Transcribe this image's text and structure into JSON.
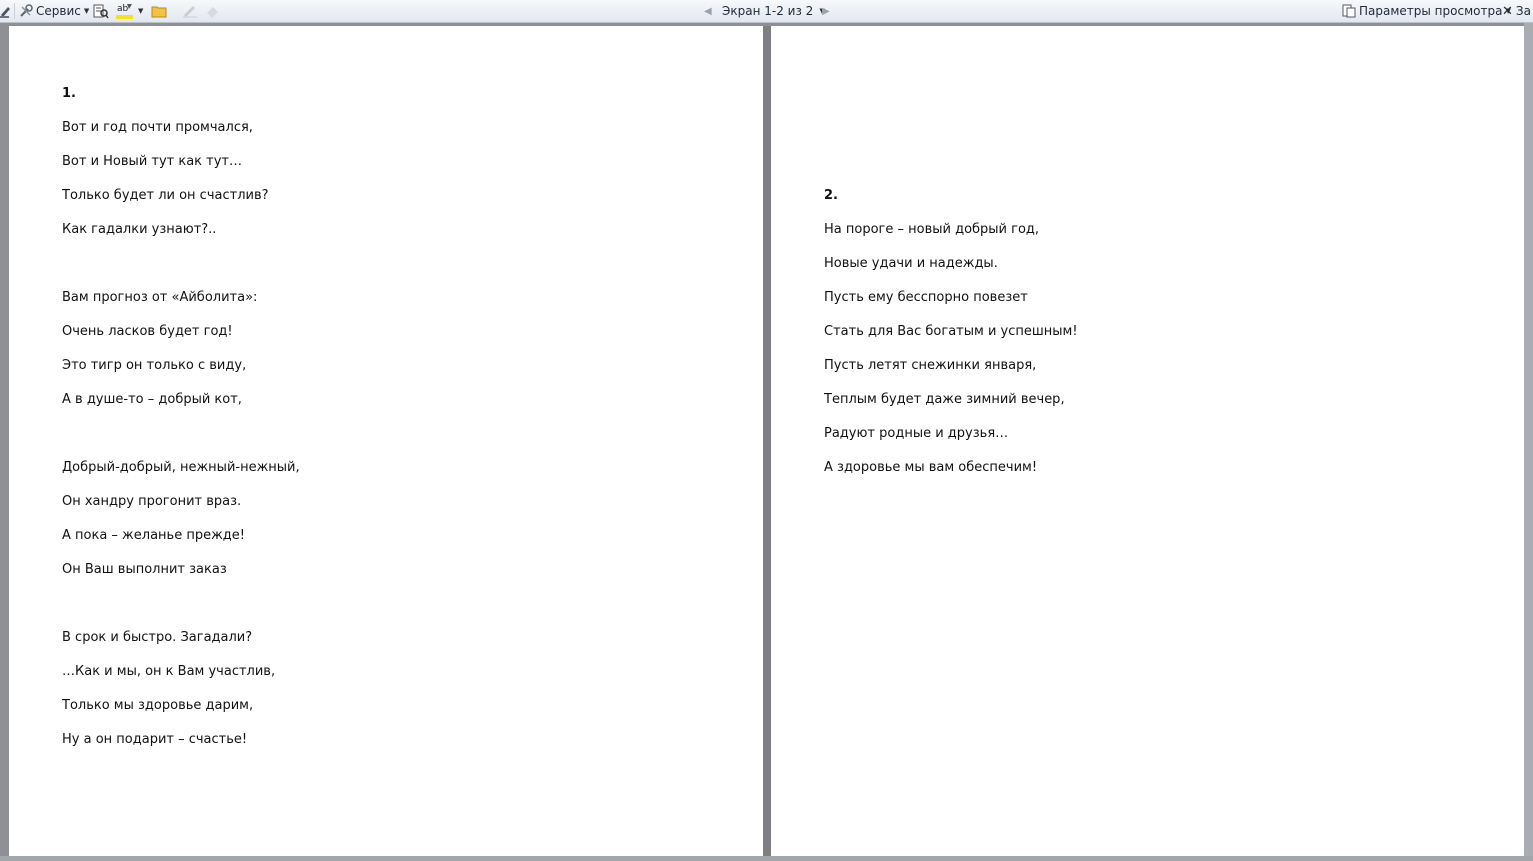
{
  "toolbar": {
    "service_label": "Сервис",
    "nav_label": "Экран 1-2 из 2",
    "view_options_label": "Параметры просмотра",
    "close_label": "За"
  },
  "pages": [
    {
      "number": "1.",
      "lines": [
        "Вот и год почти промчался,",
        "Вот и Новый тут как тут…",
        "Только будет ли он счастлив?",
        "Как гадалки узнают?..",
        "",
        "Вам прогноз от «Айболита»:",
        "Очень ласков будет год!",
        "Это тигр он только с виду,",
        "А в душе-то – добрый кот,",
        "",
        "Добрый-добрый, нежный-нежный,",
        "Он хандру прогонит враз.",
        "А пока – желанье прежде!",
        "Он Ваш выполнит заказ",
        "",
        "В срок и быстро. Загадали?",
        "…Как и мы, он к Вам участлив,",
        "Только мы здоровье дарим,",
        "Ну а он подарит – счастье!"
      ]
    },
    {
      "number": "2.",
      "lines": [
        "На пороге – новый добрый год,",
        "Новые удачи и надежды.",
        "Пусть ему бесспорно повезет",
        "Стать для Вас богатым и успешным!",
        "Пусть летят снежинки января,",
        "Теплым будет даже зимний вечер,",
        "Радуют родные и друзья…",
        "А здоровье мы вам обеспечим!"
      ]
    }
  ]
}
